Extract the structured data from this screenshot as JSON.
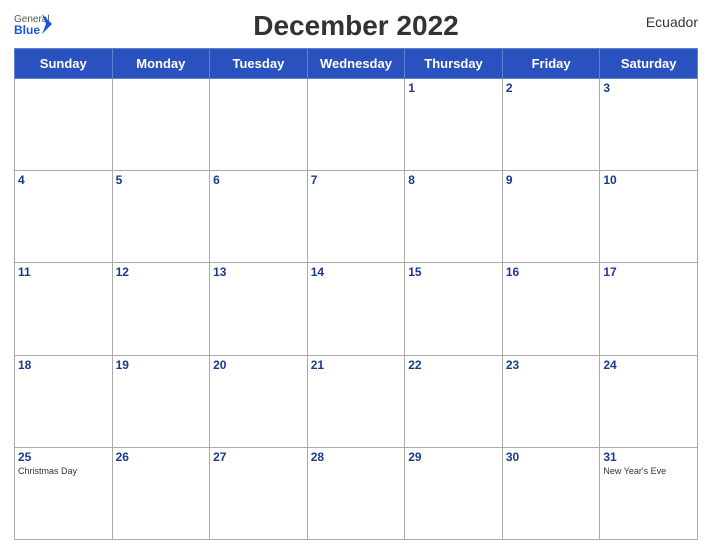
{
  "header": {
    "title": "December 2022",
    "country": "Ecuador",
    "logo_general": "General",
    "logo_blue": "Blue"
  },
  "days_of_week": [
    "Sunday",
    "Monday",
    "Tuesday",
    "Wednesday",
    "Thursday",
    "Friday",
    "Saturday"
  ],
  "weeks": [
    [
      {
        "date": "",
        "event": ""
      },
      {
        "date": "",
        "event": ""
      },
      {
        "date": "",
        "event": ""
      },
      {
        "date": "",
        "event": ""
      },
      {
        "date": "1",
        "event": ""
      },
      {
        "date": "2",
        "event": ""
      },
      {
        "date": "3",
        "event": ""
      }
    ],
    [
      {
        "date": "4",
        "event": ""
      },
      {
        "date": "5",
        "event": ""
      },
      {
        "date": "6",
        "event": ""
      },
      {
        "date": "7",
        "event": ""
      },
      {
        "date": "8",
        "event": ""
      },
      {
        "date": "9",
        "event": ""
      },
      {
        "date": "10",
        "event": ""
      }
    ],
    [
      {
        "date": "11",
        "event": ""
      },
      {
        "date": "12",
        "event": ""
      },
      {
        "date": "13",
        "event": ""
      },
      {
        "date": "14",
        "event": ""
      },
      {
        "date": "15",
        "event": ""
      },
      {
        "date": "16",
        "event": ""
      },
      {
        "date": "17",
        "event": ""
      }
    ],
    [
      {
        "date": "18",
        "event": ""
      },
      {
        "date": "19",
        "event": ""
      },
      {
        "date": "20",
        "event": ""
      },
      {
        "date": "21",
        "event": ""
      },
      {
        "date": "22",
        "event": ""
      },
      {
        "date": "23",
        "event": ""
      },
      {
        "date": "24",
        "event": ""
      }
    ],
    [
      {
        "date": "25",
        "event": "Christmas Day"
      },
      {
        "date": "26",
        "event": ""
      },
      {
        "date": "27",
        "event": ""
      },
      {
        "date": "28",
        "event": ""
      },
      {
        "date": "29",
        "event": ""
      },
      {
        "date": "30",
        "event": ""
      },
      {
        "date": "31",
        "event": "New Year's Eve"
      }
    ]
  ],
  "colors": {
    "header_bg": "#2a52be",
    "header_text": "#ffffff",
    "day_number": "#1a3a8a",
    "border": "#aaaaaa"
  }
}
